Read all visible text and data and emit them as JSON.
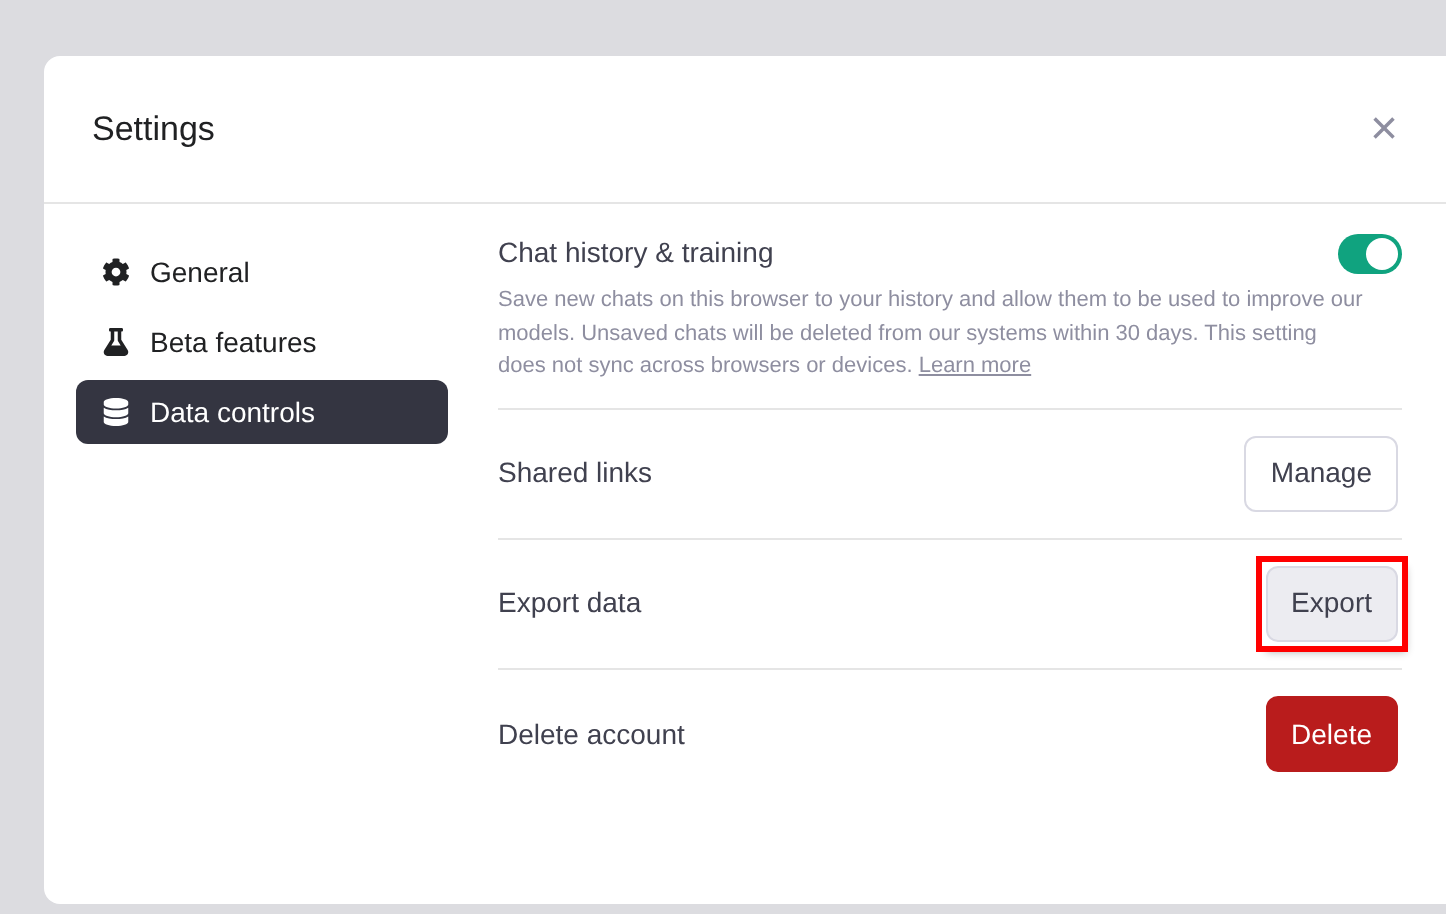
{
  "dialog": {
    "title": "Settings",
    "close": "×"
  },
  "sidebar": {
    "items": [
      {
        "label": "General",
        "selected": false
      },
      {
        "label": "Beta features",
        "selected": false
      },
      {
        "label": "Data controls",
        "selected": true
      }
    ]
  },
  "settings": [
    {
      "kind": "toggle",
      "label": "Chat history & training",
      "on": true,
      "description": "Save new chats on this browser to your history and allow them to be used to improve our models. Unsaved chats will be deleted from our systems within 30 days. This setting does not sync across browsers or devices.",
      "link": "Learn more"
    },
    {
      "kind": "button",
      "label": "Shared links",
      "button": {
        "label": "Manage",
        "kind": "outline"
      },
      "highlighted": false
    },
    {
      "kind": "button",
      "label": "Export data",
      "button": {
        "label": "Export",
        "kind": "pressed"
      },
      "highlighted": true
    },
    {
      "kind": "button",
      "label": "Delete account",
      "button": {
        "label": "Delete",
        "kind": "danger"
      },
      "highlighted": false
    }
  ]
}
